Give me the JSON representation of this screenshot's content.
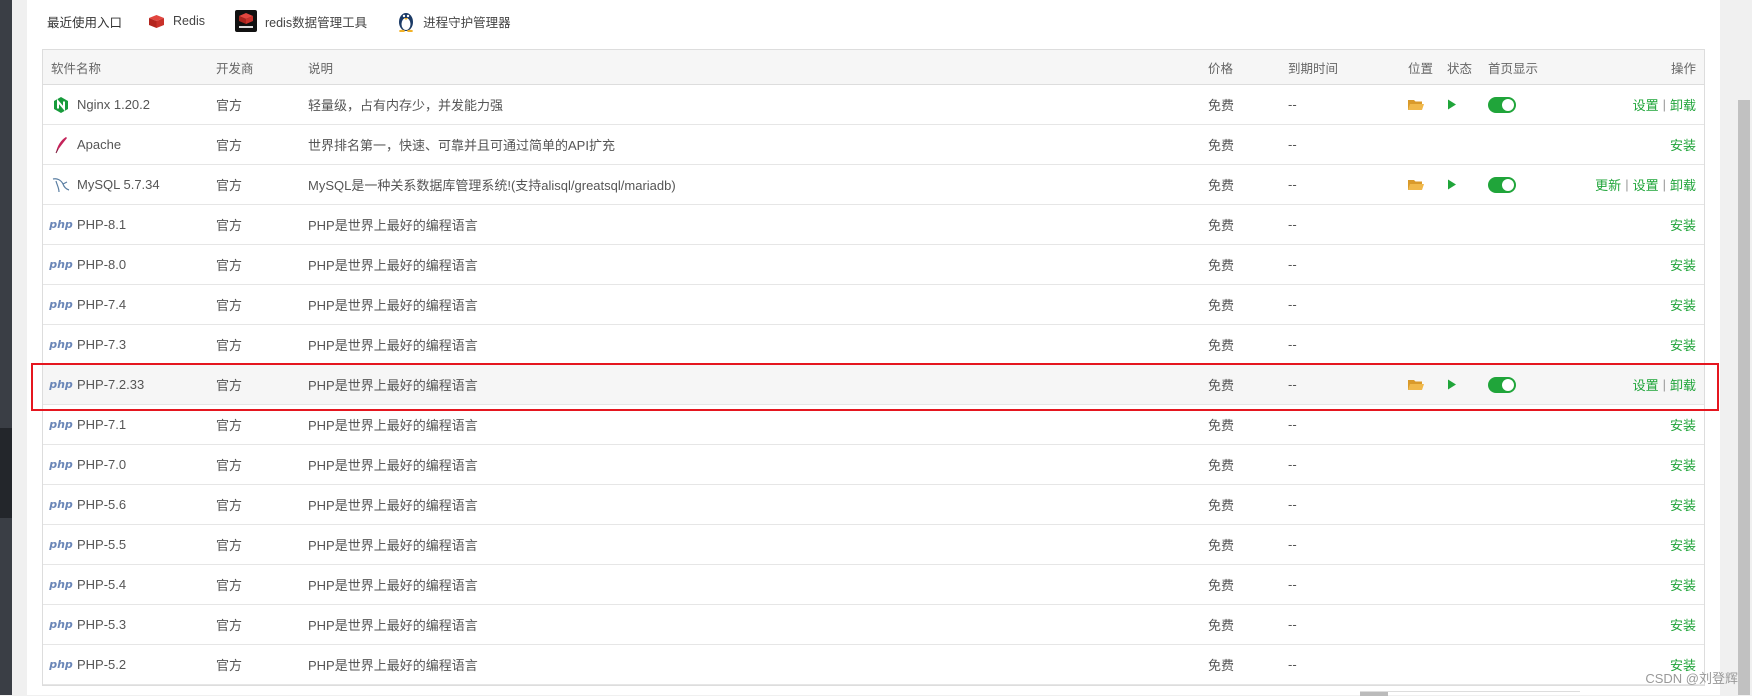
{
  "recent": {
    "label": "最近使用入口",
    "items": [
      {
        "label": "Redis",
        "icon": "redis-cube-icon"
      },
      {
        "label": "redis数据管理工具",
        "icon": "redis-logo-icon"
      },
      {
        "label": "进程守护管理器",
        "icon": "tux-penguin-icon"
      }
    ]
  },
  "table": {
    "headers": {
      "name": "软件名称",
      "developer": "开发商",
      "description": "说明",
      "price": "价格",
      "expiry": "到期时间",
      "location": "位置",
      "status": "状态",
      "homepage": "首页显示",
      "actions": "操作"
    },
    "rows": [
      {
        "name": "Nginx 1.20.2",
        "developer": "官方",
        "description": "轻量级，占有内存少，并发能力强",
        "price": "免费",
        "expiry": "--",
        "icon": "nginx-icon",
        "installed": true,
        "actions": [
          "设置",
          "卸载"
        ]
      },
      {
        "name": "Apache",
        "developer": "官方",
        "description": "世界排名第一，快速、可靠并且可通过简单的API扩充",
        "price": "免费",
        "expiry": "--",
        "icon": "apache-feather-icon",
        "installed": false,
        "actions": [
          "安装"
        ]
      },
      {
        "name": "MySQL 5.7.34",
        "developer": "官方",
        "description": "MySQL是一种关系数据库管理系统!(支持alisql/greatsql/mariadb)",
        "price": "免费",
        "expiry": "--",
        "icon": "mysql-dolphin-icon",
        "installed": true,
        "actions": [
          "更新",
          "设置",
          "卸载"
        ]
      },
      {
        "name": "PHP-8.1",
        "developer": "官方",
        "description": "PHP是世界上最好的编程语言",
        "price": "免费",
        "expiry": "--",
        "icon": "php-icon",
        "installed": false,
        "actions": [
          "安装"
        ]
      },
      {
        "name": "PHP-8.0",
        "developer": "官方",
        "description": "PHP是世界上最好的编程语言",
        "price": "免费",
        "expiry": "--",
        "icon": "php-icon",
        "installed": false,
        "actions": [
          "安装"
        ]
      },
      {
        "name": "PHP-7.4",
        "developer": "官方",
        "description": "PHP是世界上最好的编程语言",
        "price": "免费",
        "expiry": "--",
        "icon": "php-icon",
        "installed": false,
        "actions": [
          "安装"
        ]
      },
      {
        "name": "PHP-7.3",
        "developer": "官方",
        "description": "PHP是世界上最好的编程语言",
        "price": "免费",
        "expiry": "--",
        "icon": "php-icon",
        "installed": false,
        "actions": [
          "安装"
        ]
      },
      {
        "name": "PHP-7.2.33",
        "developer": "官方",
        "description": "PHP是世界上最好的编程语言",
        "price": "免费",
        "expiry": "--",
        "icon": "php-icon",
        "installed": true,
        "highlighted": true,
        "actions": [
          "设置",
          "卸载"
        ]
      },
      {
        "name": "PHP-7.1",
        "developer": "官方",
        "description": "PHP是世界上最好的编程语言",
        "price": "免费",
        "expiry": "--",
        "icon": "php-icon",
        "installed": false,
        "actions": [
          "安装"
        ]
      },
      {
        "name": "PHP-7.0",
        "developer": "官方",
        "description": "PHP是世界上最好的编程语言",
        "price": "免费",
        "expiry": "--",
        "icon": "php-icon",
        "installed": false,
        "actions": [
          "安装"
        ]
      },
      {
        "name": "PHP-5.6",
        "developer": "官方",
        "description": "PHP是世界上最好的编程语言",
        "price": "免费",
        "expiry": "--",
        "icon": "php-icon",
        "installed": false,
        "actions": [
          "安装"
        ]
      },
      {
        "name": "PHP-5.5",
        "developer": "官方",
        "description": "PHP是世界上最好的编程语言",
        "price": "免费",
        "expiry": "--",
        "icon": "php-icon",
        "installed": false,
        "actions": [
          "安装"
        ]
      },
      {
        "name": "PHP-5.4",
        "developer": "官方",
        "description": "PHP是世界上最好的编程语言",
        "price": "免费",
        "expiry": "--",
        "icon": "php-icon",
        "installed": false,
        "actions": [
          "安装"
        ]
      },
      {
        "name": "PHP-5.3",
        "developer": "官方",
        "description": "PHP是世界上最好的编程语言",
        "price": "免费",
        "expiry": "--",
        "icon": "php-icon",
        "installed": false,
        "actions": [
          "安装"
        ]
      },
      {
        "name": "PHP-5.2",
        "developer": "官方",
        "description": "PHP是世界上最好的编程语言",
        "price": "免费",
        "expiry": "--",
        "icon": "php-icon",
        "installed": false,
        "actions": [
          "安装"
        ]
      }
    ]
  },
  "php_icon_text": "php",
  "watermark": "CSDN @刘登辉",
  "colors": {
    "accent": "#20a53a",
    "folder": "#f0b84a",
    "highlight_border": "#e5161f"
  }
}
